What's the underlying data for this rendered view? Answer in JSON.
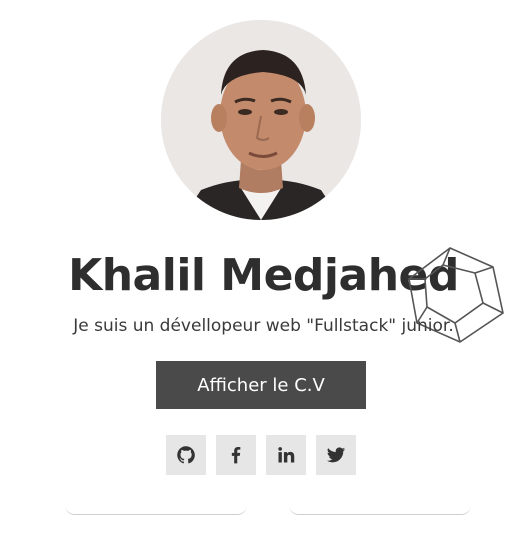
{
  "profile": {
    "name": "Khalil Medjahed",
    "tagline": "Je suis un dévellopeur web \"Fullstack\" junior."
  },
  "actions": {
    "cv_button_label": "Afficher le C.V"
  },
  "socials": [
    {
      "icon": "github-icon"
    },
    {
      "icon": "facebook-icon"
    },
    {
      "icon": "linkedin-icon"
    },
    {
      "icon": "twitter-icon"
    }
  ],
  "colors": {
    "button_bg": "#4a4a4a",
    "social_bg": "#e6e6e6",
    "text": "#333333"
  }
}
